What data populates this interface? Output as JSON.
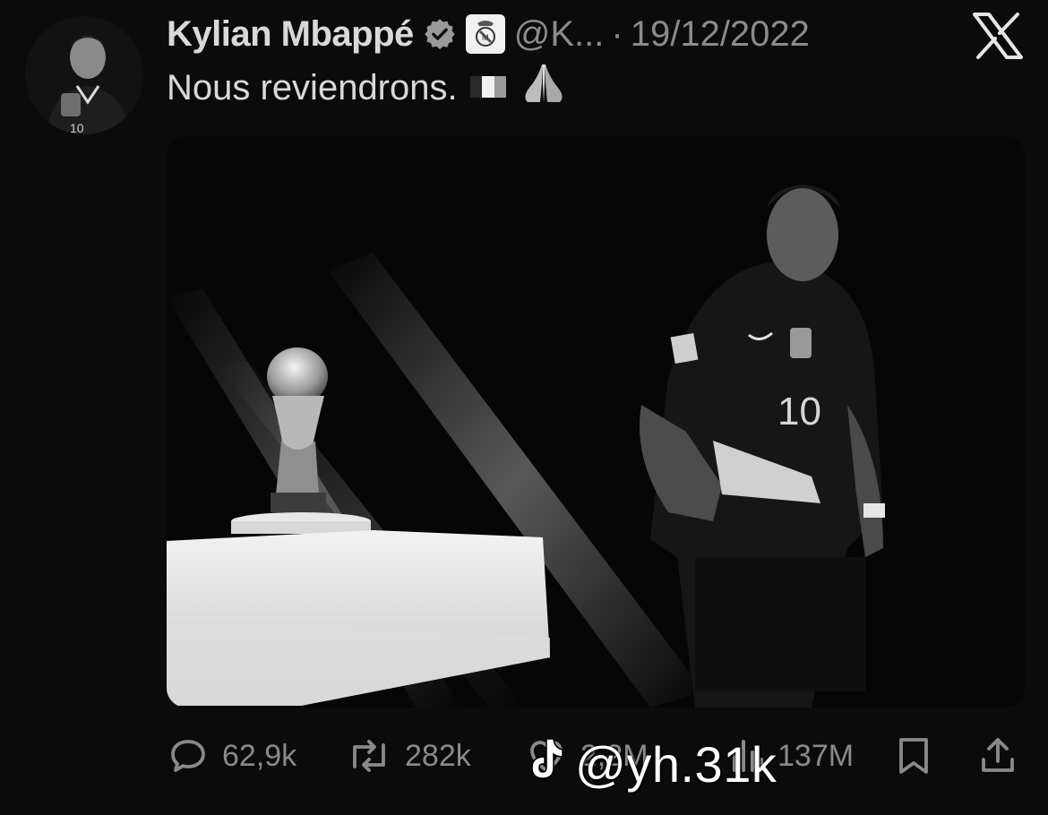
{
  "tweet": {
    "author_name": "Kylian Mbappé",
    "handle": "@K...",
    "separator": "·",
    "date": "19/12/2022",
    "text": "Nous reviendrons.",
    "emojis": [
      "flag-france",
      "folded-hands"
    ]
  },
  "media": {
    "jersey_number": "10"
  },
  "actions": {
    "replies": "62,9k",
    "reposts": "282k",
    "likes": "2,2M",
    "views": "137M"
  },
  "watermark": {
    "text": "@yh.31k"
  },
  "icons": {
    "verified": "verified-badge-icon",
    "affiliate": "real-madrid-crest-icon",
    "brand": "x-logo-icon",
    "reply": "reply-icon",
    "repost": "repost-icon",
    "like": "heart-icon",
    "views": "views-icon",
    "bookmark": "bookmark-icon",
    "share": "share-icon",
    "tiktok": "tiktok-icon"
  },
  "colors": {
    "background": "#0b0b0b",
    "primary_text": "#d9d9d9",
    "secondary_text": "#8b8b8b"
  }
}
